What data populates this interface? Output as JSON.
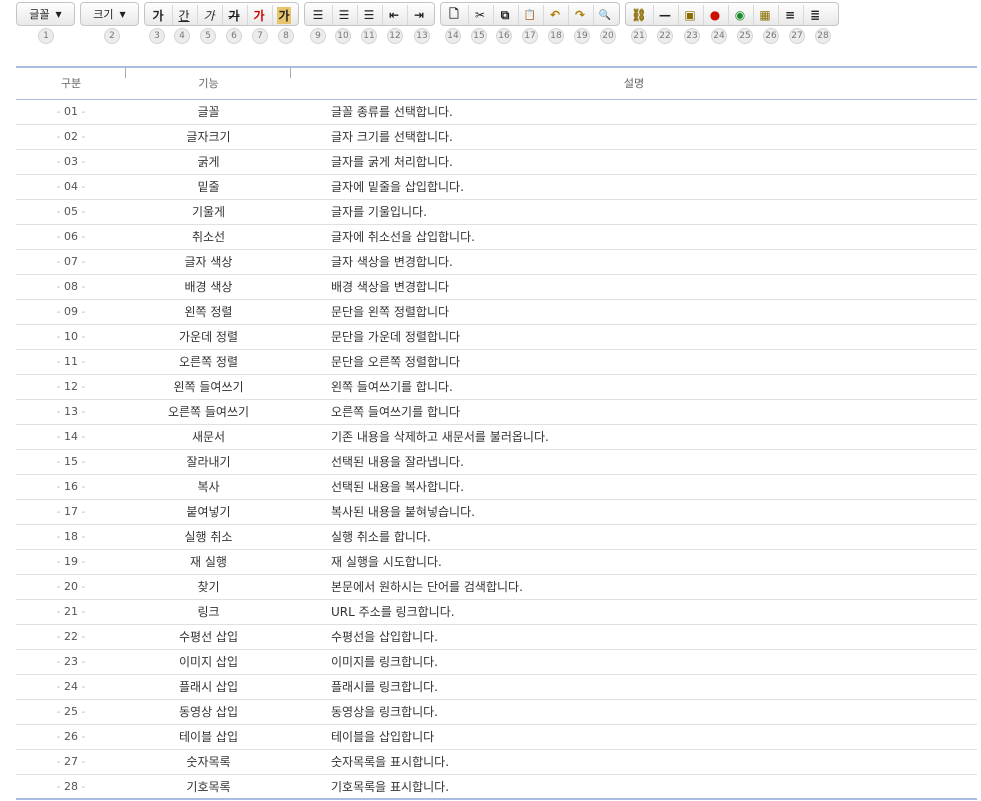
{
  "toolbar": {
    "font_select": "글꼴",
    "size_select": "크기",
    "buttons": [
      {
        "glyph": "가",
        "icon": "bold-icon"
      },
      {
        "glyph": "간",
        "icon": "underline-icon"
      },
      {
        "glyph": "가",
        "icon": "italic-icon"
      },
      {
        "glyph": "가",
        "icon": "strikethrough-icon"
      },
      {
        "glyph": "가",
        "icon": "font-color-icon"
      },
      {
        "glyph": "가",
        "icon": "background-color-icon"
      },
      {
        "glyph": "☰",
        "icon": "align-left-icon"
      },
      {
        "glyph": "☰",
        "icon": "align-center-icon"
      },
      {
        "glyph": "☰",
        "icon": "align-right-icon"
      },
      {
        "glyph": "⇤",
        "icon": "outdent-icon"
      },
      {
        "glyph": "⇥",
        "icon": "indent-icon"
      },
      {
        "glyph": "🗋",
        "icon": "new-document-icon"
      },
      {
        "glyph": "✂",
        "icon": "cut-icon"
      },
      {
        "glyph": "⧉",
        "icon": "copy-icon"
      },
      {
        "glyph": "📋",
        "icon": "paste-icon"
      },
      {
        "glyph": "↶",
        "icon": "undo-icon"
      },
      {
        "glyph": "↷",
        "icon": "redo-icon"
      },
      {
        "glyph": "🔍",
        "icon": "find-icon"
      },
      {
        "glyph": "⛓",
        "icon": "link-icon"
      },
      {
        "glyph": "—",
        "icon": "horizontal-rule-icon"
      },
      {
        "glyph": "▣",
        "icon": "image-icon"
      },
      {
        "glyph": "●",
        "icon": "flash-icon"
      },
      {
        "glyph": "◉",
        "icon": "video-icon"
      },
      {
        "glyph": "▦",
        "icon": "table-icon"
      },
      {
        "glyph": "≡",
        "icon": "numbered-list-icon"
      },
      {
        "glyph": "≣",
        "icon": "bullet-list-icon"
      }
    ],
    "numbers": [
      "1",
      "2",
      "3",
      "4",
      "5",
      "6",
      "7",
      "8",
      "9",
      "10",
      "11",
      "12",
      "13",
      "14",
      "15",
      "16",
      "17",
      "18",
      "19",
      "20",
      "21",
      "22",
      "23",
      "24",
      "25",
      "26",
      "27",
      "28"
    ]
  },
  "table": {
    "headers": [
      "구분",
      "기능",
      "설명"
    ],
    "rows": [
      [
        "01",
        "글꼴",
        "글꼴 종류를 선택합니다."
      ],
      [
        "02",
        "글자크기",
        "글자 크기를 선택합니다."
      ],
      [
        "03",
        "굵게",
        "글자를 굵게 처리합니다."
      ],
      [
        "04",
        "밑줄",
        "글자에 밑줄을 삽입합니다."
      ],
      [
        "05",
        "기울게",
        "글자를 기울입니다."
      ],
      [
        "06",
        "취소선",
        "글자에 취소선을 삽입합니다."
      ],
      [
        "07",
        "글자 색상",
        "글자 색상을 변경합니다."
      ],
      [
        "08",
        "배경 색상",
        "배경 색상을 변경합니다"
      ],
      [
        "09",
        "왼쪽 정렬",
        "문단을 왼쪽 정렬합니다"
      ],
      [
        "10",
        "가운데 정렬",
        "문단을 가운데 정렬합니다"
      ],
      [
        "11",
        "오른쪽 정렬",
        "문단을 오른쪽 정렬합니다"
      ],
      [
        "12",
        "왼쪽 들여쓰기",
        "왼쪽 들여쓰기를 합니다."
      ],
      [
        "13",
        "오른쪽 들여쓰기",
        "오른쪽 들여쓰기를 합니다"
      ],
      [
        "14",
        "새문서",
        "기존 내용을 삭제하고 새문서를 불러옵니다."
      ],
      [
        "15",
        "잘라내기",
        "선택된 내용을 잘라냅니다."
      ],
      [
        "16",
        "복사",
        "선택된 내용을 복사합니다."
      ],
      [
        "17",
        "붙여넣기",
        "복사된 내용을 붙혀넣습니다."
      ],
      [
        "18",
        "실행 취소",
        "실행 취소를 합니다."
      ],
      [
        "19",
        "재 실행",
        "재 실행을 시도합니다."
      ],
      [
        "20",
        "찾기",
        "본문에서 원하시는 단어를 검색합니다."
      ],
      [
        "21",
        "링크",
        "URL 주소를 링크합니다."
      ],
      [
        "22",
        "수평선 삽입",
        "수평선을 삽입합니다."
      ],
      [
        "23",
        "이미지 삽입",
        "이미지를 링크합니다."
      ],
      [
        "24",
        "플래시 삽입",
        "플래시를 링크합니다."
      ],
      [
        "25",
        "동영상 삽입",
        "동영상을 링크합니다."
      ],
      [
        "26",
        "테이블 삽입",
        "테이블을 삽입합니다"
      ],
      [
        "27",
        "숫자목록",
        "숫자목록을 표시합니다."
      ],
      [
        "28",
        "기호목록",
        "기호목록을 표시합니다."
      ]
    ]
  }
}
